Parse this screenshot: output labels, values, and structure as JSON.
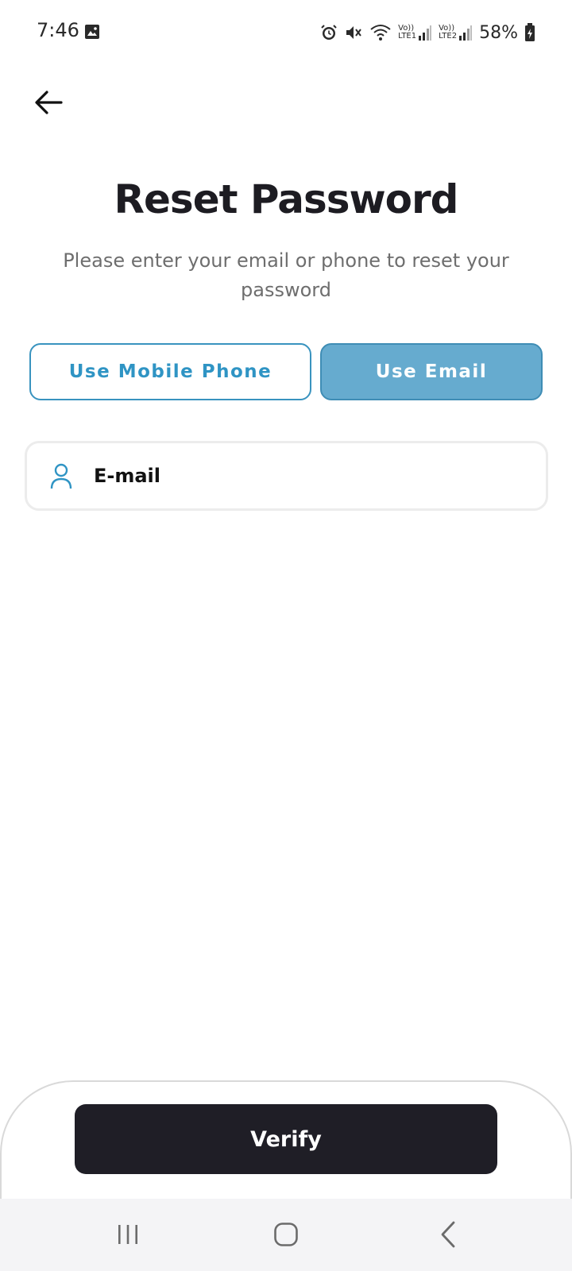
{
  "status_bar": {
    "time": "7:46",
    "sim1_label_top": "Vo))",
    "sim1_label_bottom": "LTE1",
    "sim2_label_top": "Vo))",
    "sim2_label_bottom": "LTE2",
    "battery": "58%",
    "icons": [
      "gallery-icon",
      "alarm-icon",
      "mute-icon",
      "wifi-icon",
      "signal-icon",
      "signal-icon",
      "battery-icon"
    ]
  },
  "header": {
    "back_icon": "arrow-left-icon"
  },
  "main": {
    "title": "Reset Password",
    "subtitle": "Please enter your email or phone to reset your password",
    "tabs": [
      {
        "label": "Use Mobile Phone",
        "selected": false
      },
      {
        "label": "Use Email",
        "selected": true
      }
    ],
    "email_field": {
      "icon": "user-icon",
      "placeholder": "E-mail",
      "value": ""
    }
  },
  "footer": {
    "verify_label": "Verify"
  },
  "nav": {
    "items": [
      "recent-apps-icon",
      "home-icon",
      "back-icon"
    ]
  },
  "colors": {
    "accent": "#2f94c4",
    "tab_selected_bg": "#66abcf",
    "primary_button": "#1f1e26",
    "title_text": "#1d1c22",
    "subtitle_text": "#6e6e6e"
  }
}
